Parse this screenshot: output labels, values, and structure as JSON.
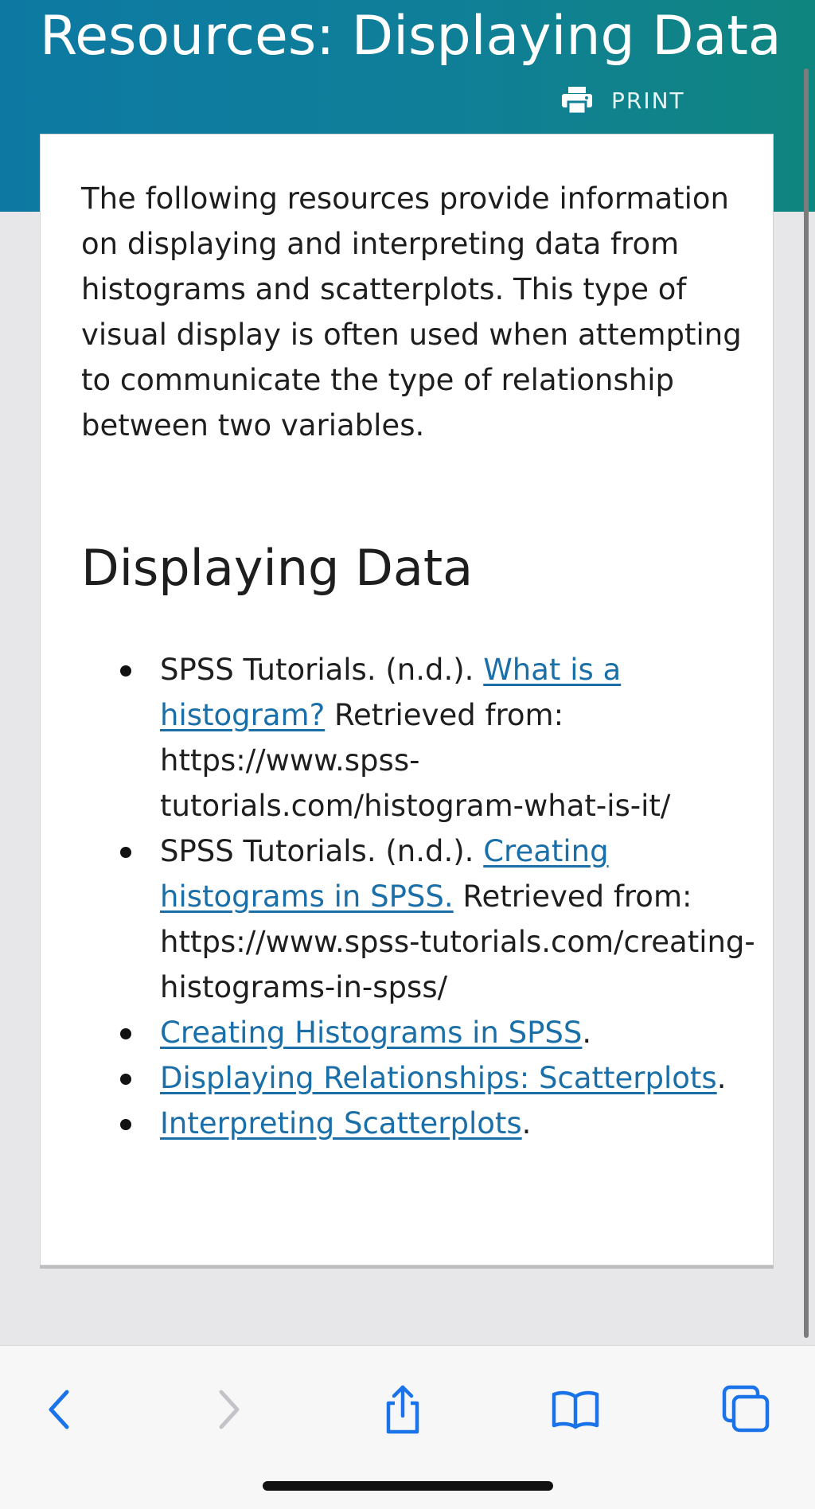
{
  "header": {
    "title": "Resources: Displaying Data",
    "print_label": "PRINT"
  },
  "content": {
    "intro": "The following resources provide information on displaying and interpreting data from histograms and scatterplots. This type of visual display is often used when attempting to communicate the type of relationship between two variables.",
    "section_heading": "Displaying Data",
    "resources": [
      {
        "prefix": "SPSS Tutorials. (n.d.). ",
        "link_text": "What is a histogram?",
        "suffix": " Retrieved from: https://www.spss-tutorials.com/histogram-what-is-it/"
      },
      {
        "prefix": "SPSS Tutorials. (n.d.). ",
        "link_text": "Creating histograms in SPSS.",
        "suffix": " Retrieved from: https://www.spss-tutorials.com/creating-histograms-in-spss/"
      },
      {
        "prefix": "",
        "link_text": "Creating Histograms in SPSS",
        "suffix": "."
      },
      {
        "prefix": "",
        "link_text": "Displaying Relationships: Scatterplots",
        "suffix": "."
      },
      {
        "prefix": "",
        "link_text": "Interpreting Scatterplots",
        "suffix": "."
      }
    ]
  },
  "toolbar": {
    "icons": [
      "back-icon",
      "forward-icon",
      "share-icon",
      "bookmarks-icon",
      "tabs-icon"
    ],
    "colors": {
      "active": "#1a73e8",
      "disabled": "#c4c4c8"
    }
  },
  "colors": {
    "header_gradient_start": "#0d79a3",
    "header_gradient_end": "#0f857f",
    "link": "#1b6fa8",
    "text": "#1e1e1e",
    "page_background": "#e7e7e9"
  }
}
